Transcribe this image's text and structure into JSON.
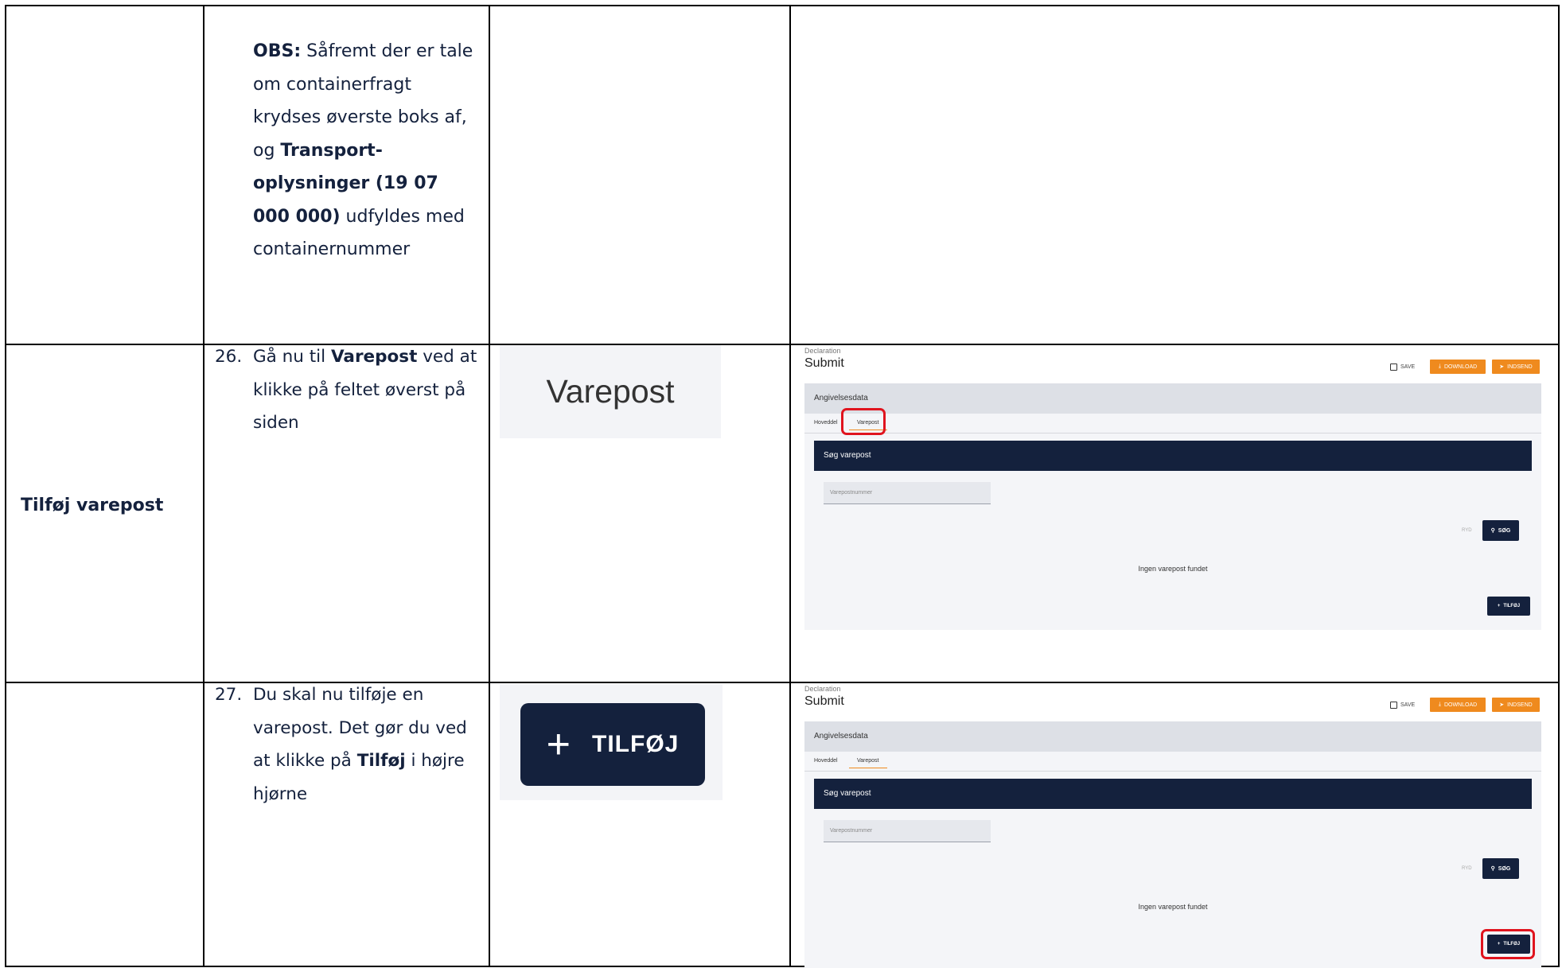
{
  "row1": {
    "obs_label": "OBS:",
    "obs_text_1": " Såfremt der er tale om containerfragt krydses øverste boks af, og ",
    "obs_bold": "Transport-oplysninger (19 07 000 000)",
    "obs_text_2": " udfyldes med containernummer"
  },
  "row2": {
    "label": "Tilføj varepost",
    "step_number": "26.",
    "step_text_1": "Gå nu til ",
    "step_bold": "Varepost",
    "step_text_2": " ved at klikke på feltet øverst på siden",
    "zoom_label": "Varepost"
  },
  "row3": {
    "step_number": "27.",
    "step_text_1": "Du skal nu tilføje en varepost. Det gør du ved at klikke på ",
    "step_bold": "Tilføj",
    "step_text_2": " i højre hjørne",
    "zoom_button_label": "TILFØJ"
  },
  "screenshot": {
    "breadcrumb": "Declaration",
    "title": "Submit",
    "save_label": "SAVE",
    "download_label": "DOWNLOAD",
    "send_label": "INDSEND",
    "panel_title": "Angivelsesdata",
    "tab_main": "Hoveddel",
    "tab_item": "Varepost",
    "search_title": "Søg varepost",
    "input_placeholder": "Varepostnummer",
    "clear_label": "RYD",
    "search_label": "SØG",
    "empty_message": "Ingen varepost fundet",
    "add_label": "TILFØJ"
  },
  "colors": {
    "navy": "#14213d",
    "orange": "#ef8a1e",
    "highlight": "#e0141e"
  }
}
